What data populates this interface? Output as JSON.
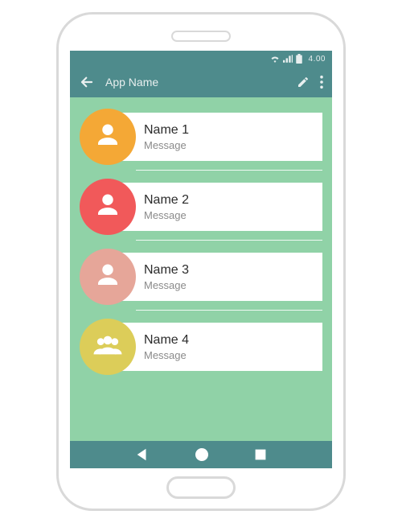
{
  "status": {
    "time": "4.00"
  },
  "appbar": {
    "title": "App Name"
  },
  "contacts": [
    {
      "name": "Name 1",
      "message": "Message",
      "color": "orange",
      "type": "person"
    },
    {
      "name": "Name 2",
      "message": "Message",
      "color": "red",
      "type": "person"
    },
    {
      "name": "Name 3",
      "message": "Message",
      "color": "pink",
      "type": "person"
    },
    {
      "name": "Name 4",
      "message": "Message",
      "color": "yellow",
      "type": "group"
    }
  ],
  "colors": {
    "orange": "#f4a836",
    "red": "#f1595a",
    "pink": "#e6a699",
    "yellow": "#dccd59",
    "accent": "#4e8b8c",
    "bg": "#90d2a7"
  }
}
